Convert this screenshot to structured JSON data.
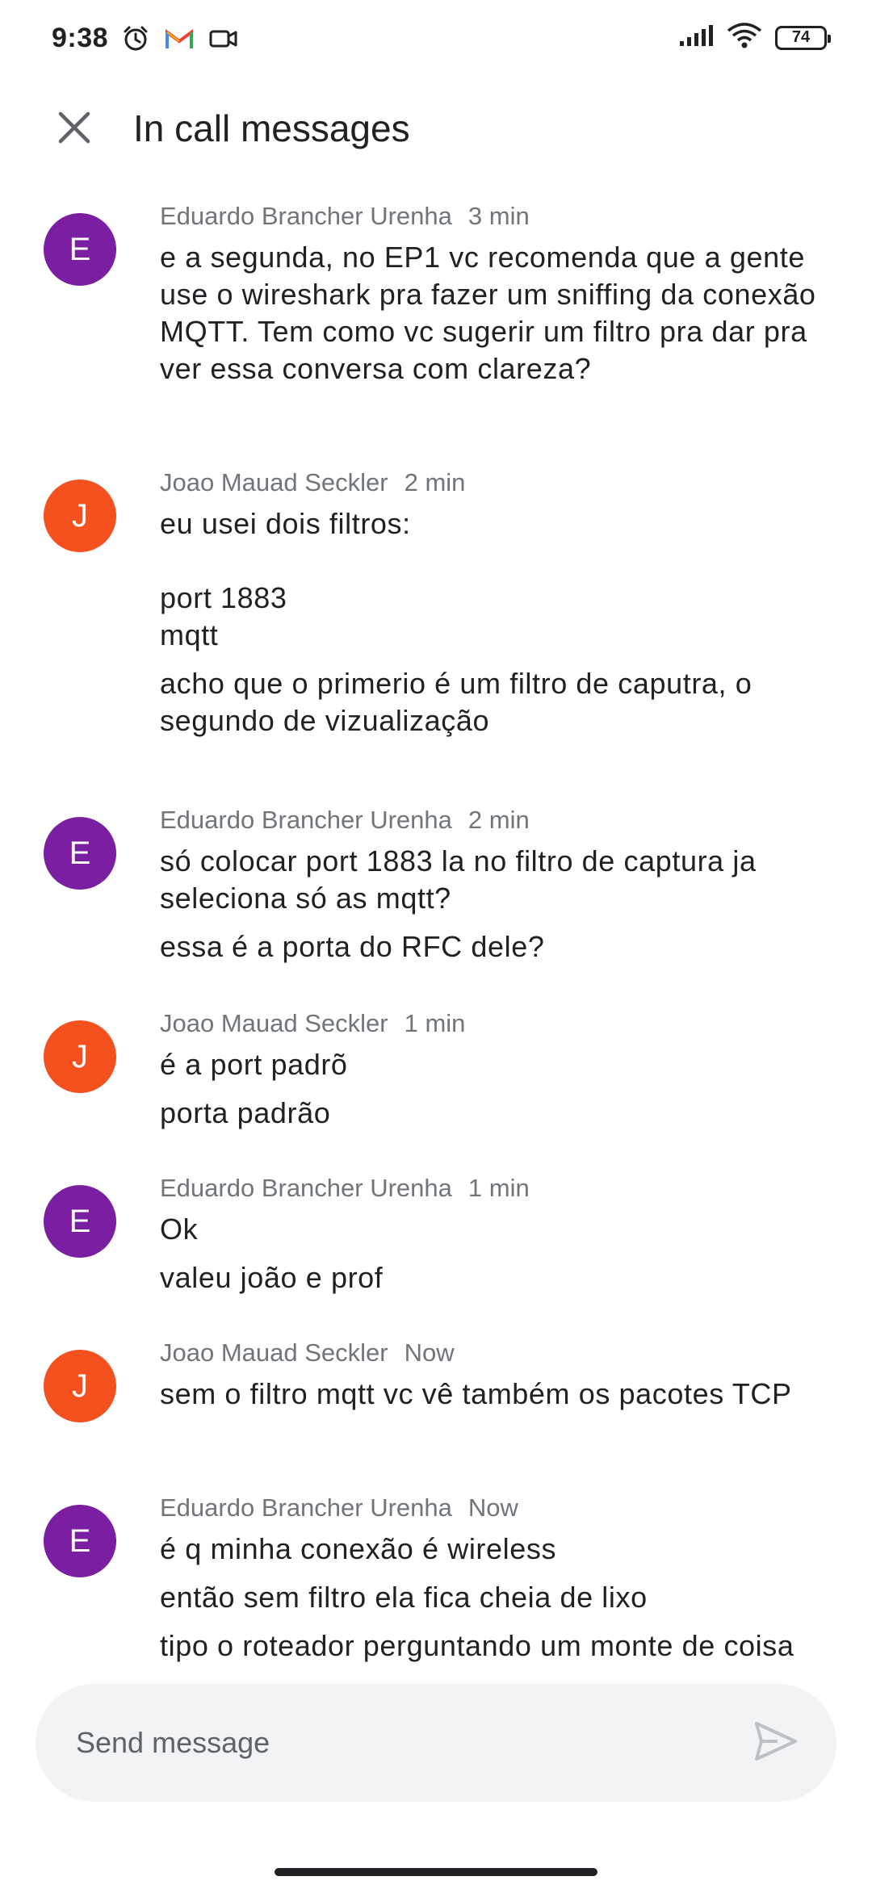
{
  "status_bar": {
    "time": "9:38",
    "battery": "74",
    "icons_left": [
      "alarm-icon",
      "gmail-icon",
      "video-camera-icon"
    ],
    "icons_right": [
      "signal-icon",
      "wifi-icon",
      "battery-icon"
    ]
  },
  "header": {
    "title": "In call messages",
    "close_icon": "close-icon"
  },
  "messages": [
    {
      "sender": "Eduardo Brancher Urenha",
      "time": "3 min",
      "avatar_letter": "E",
      "avatar_color": "#7b1fa2",
      "lines": [
        "e a segunda, no EP1 vc recomenda que a gente use o wireshark pra fazer um sniffing da conexão MQTT. Tem como vc sugerir um filtro pra dar pra ver essa conversa com clareza?"
      ]
    },
    {
      "sender": "Joao Mauad Seckler",
      "time": "2 min",
      "avatar_letter": "J",
      "avatar_color": "#f4511e",
      "lines": [
        "eu usei dois filtros:\n\nport 1883\nmqtt",
        "acho que o primerio é um filtro de caputra, o segundo de vizualização"
      ]
    },
    {
      "sender": "Eduardo Brancher Urenha",
      "time": "2 min",
      "avatar_letter": "E",
      "avatar_color": "#7b1fa2",
      "lines": [
        "só colocar port 1883 la no filtro de captura ja seleciona só as mqtt?",
        "essa é a porta do RFC dele?"
      ]
    },
    {
      "sender": "Joao Mauad Seckler",
      "time": "1 min",
      "avatar_letter": "J",
      "avatar_color": "#f4511e",
      "lines": [
        "é a port padrõ",
        "porta padrão"
      ]
    },
    {
      "sender": "Eduardo Brancher Urenha",
      "time": "1 min",
      "avatar_letter": "E",
      "avatar_color": "#7b1fa2",
      "lines": [
        "Ok",
        "valeu joão e prof"
      ]
    },
    {
      "sender": "Joao Mauad Seckler",
      "time": "Now",
      "avatar_letter": "J",
      "avatar_color": "#f4511e",
      "lines": [
        "sem o filtro mqtt vc vê também os pacotes TCP"
      ]
    },
    {
      "sender": "Eduardo Brancher Urenha",
      "time": "Now",
      "avatar_letter": "E",
      "avatar_color": "#7b1fa2",
      "lines": [
        "é q minha conexão é wireless",
        "então sem filtro ela fica cheia de lixo",
        "tipo o roteador perguntando um monte de coisa"
      ]
    }
  ],
  "composer": {
    "placeholder": "Send message",
    "value": "",
    "send_icon": "send-icon"
  }
}
